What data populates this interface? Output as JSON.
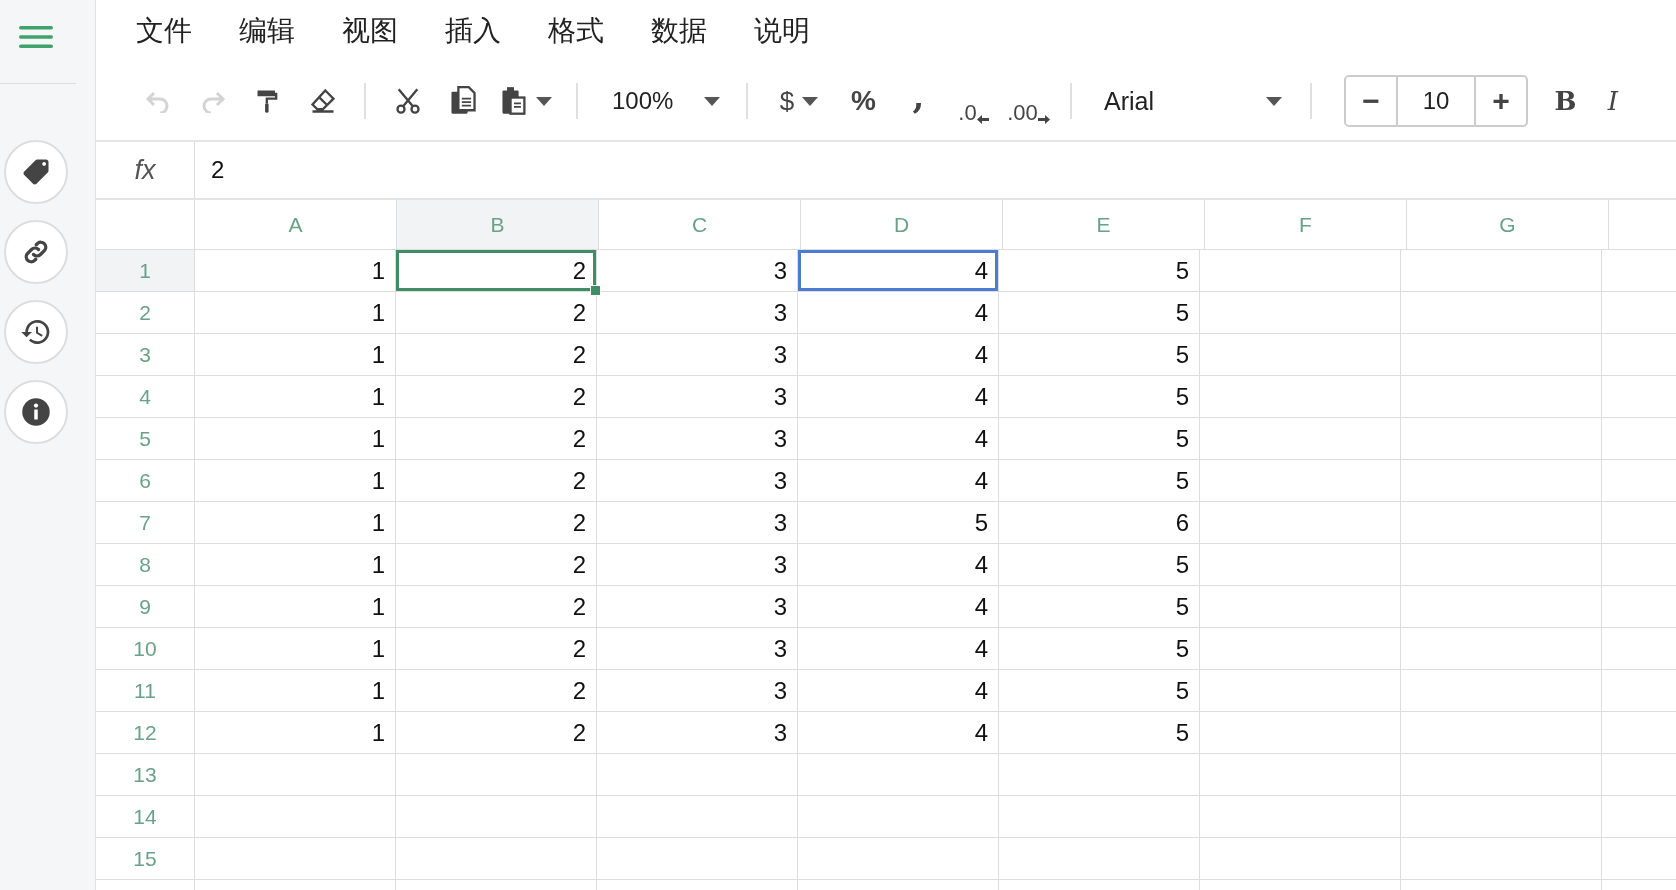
{
  "menu": [
    "文件",
    "编辑",
    "视图",
    "插入",
    "格式",
    "数据",
    "说明"
  ],
  "toolbar": {
    "undo": {
      "disabled": true
    },
    "redo": {
      "disabled": true
    },
    "zoom": "100%",
    "currency": "$",
    "percent": "%",
    "comma": ",",
    "decrease_decimals": ".0",
    "increase_decimals": ".00",
    "font": "Arial",
    "font_size": {
      "decrease": "−",
      "value": "10",
      "increase": "+"
    },
    "bold": "B",
    "italic": "I"
  },
  "formula_bar": {
    "label": "fx",
    "value": "2"
  },
  "columns": [
    {
      "label": "A",
      "selected": false
    },
    {
      "label": "B",
      "selected": true
    },
    {
      "label": "C",
      "selected": false
    },
    {
      "label": "D",
      "selected": false
    },
    {
      "label": "E",
      "selected": false
    },
    {
      "label": "F",
      "selected": false
    },
    {
      "label": "G",
      "selected": false
    }
  ],
  "rows": [
    {
      "label": "1",
      "selected": true,
      "cells": [
        {
          "value": "1",
          "selected": false,
          "peer_selected": false
        },
        {
          "value": "2",
          "selected": true,
          "peer_selected": false
        },
        {
          "value": "3",
          "selected": false,
          "peer_selected": false
        },
        {
          "value": "4",
          "selected": false,
          "peer_selected": true
        },
        {
          "value": "5",
          "selected": false,
          "peer_selected": false
        }
      ]
    },
    {
      "label": "2",
      "selected": false,
      "cells": [
        {
          "value": "1",
          "selected": false,
          "peer_selected": false
        },
        {
          "value": "2",
          "selected": false,
          "peer_selected": false
        },
        {
          "value": "3",
          "selected": false,
          "peer_selected": false
        },
        {
          "value": "4",
          "selected": false,
          "peer_selected": false
        },
        {
          "value": "5",
          "selected": false,
          "peer_selected": false
        }
      ]
    },
    {
      "label": "3",
      "selected": false,
      "cells": [
        {
          "value": "1",
          "selected": false,
          "peer_selected": false
        },
        {
          "value": "2",
          "selected": false,
          "peer_selected": false
        },
        {
          "value": "3",
          "selected": false,
          "peer_selected": false
        },
        {
          "value": "4",
          "selected": false,
          "peer_selected": false
        },
        {
          "value": "5",
          "selected": false,
          "peer_selected": false
        }
      ]
    },
    {
      "label": "4",
      "selected": false,
      "cells": [
        {
          "value": "1",
          "selected": false,
          "peer_selected": false
        },
        {
          "value": "2",
          "selected": false,
          "peer_selected": false
        },
        {
          "value": "3",
          "selected": false,
          "peer_selected": false
        },
        {
          "value": "4",
          "selected": false,
          "peer_selected": false
        },
        {
          "value": "5",
          "selected": false,
          "peer_selected": false
        }
      ]
    },
    {
      "label": "5",
      "selected": false,
      "cells": [
        {
          "value": "1",
          "selected": false,
          "peer_selected": false
        },
        {
          "value": "2",
          "selected": false,
          "peer_selected": false
        },
        {
          "value": "3",
          "selected": false,
          "peer_selected": false
        },
        {
          "value": "4",
          "selected": false,
          "peer_selected": false
        },
        {
          "value": "5",
          "selected": false,
          "peer_selected": false
        }
      ]
    },
    {
      "label": "6",
      "selected": false,
      "cells": [
        {
          "value": "1",
          "selected": false,
          "peer_selected": false
        },
        {
          "value": "2",
          "selected": false,
          "peer_selected": false
        },
        {
          "value": "3",
          "selected": false,
          "peer_selected": false
        },
        {
          "value": "4",
          "selected": false,
          "peer_selected": false
        },
        {
          "value": "5",
          "selected": false,
          "peer_selected": false
        }
      ]
    },
    {
      "label": "7",
      "selected": false,
      "cells": [
        {
          "value": "1",
          "selected": false,
          "peer_selected": false
        },
        {
          "value": "2",
          "selected": false,
          "peer_selected": false
        },
        {
          "value": "3",
          "selected": false,
          "peer_selected": false
        },
        {
          "value": "5",
          "selected": false,
          "peer_selected": false
        },
        {
          "value": "6",
          "selected": false,
          "peer_selected": false
        }
      ]
    },
    {
      "label": "8",
      "selected": false,
      "cells": [
        {
          "value": "1",
          "selected": false,
          "peer_selected": false
        },
        {
          "value": "2",
          "selected": false,
          "peer_selected": false
        },
        {
          "value": "3",
          "selected": false,
          "peer_selected": false
        },
        {
          "value": "4",
          "selected": false,
          "peer_selected": false
        },
        {
          "value": "5",
          "selected": false,
          "peer_selected": false
        }
      ]
    },
    {
      "label": "9",
      "selected": false,
      "cells": [
        {
          "value": "1",
          "selected": false,
          "peer_selected": false
        },
        {
          "value": "2",
          "selected": false,
          "peer_selected": false
        },
        {
          "value": "3",
          "selected": false,
          "peer_selected": false
        },
        {
          "value": "4",
          "selected": false,
          "peer_selected": false
        },
        {
          "value": "5",
          "selected": false,
          "peer_selected": false
        }
      ]
    },
    {
      "label": "10",
      "selected": false,
      "cells": [
        {
          "value": "1",
          "selected": false,
          "peer_selected": false
        },
        {
          "value": "2",
          "selected": false,
          "peer_selected": false
        },
        {
          "value": "3",
          "selected": false,
          "peer_selected": false
        },
        {
          "value": "4",
          "selected": false,
          "peer_selected": false
        },
        {
          "value": "5",
          "selected": false,
          "peer_selected": false
        }
      ]
    },
    {
      "label": "11",
      "selected": false,
      "cells": [
        {
          "value": "1",
          "selected": false,
          "peer_selected": false
        },
        {
          "value": "2",
          "selected": false,
          "peer_selected": false
        },
        {
          "value": "3",
          "selected": false,
          "peer_selected": false
        },
        {
          "value": "4",
          "selected": false,
          "peer_selected": false
        },
        {
          "value": "5",
          "selected": false,
          "peer_selected": false
        }
      ]
    },
    {
      "label": "12",
      "selected": false,
      "cells": [
        {
          "value": "1",
          "selected": false,
          "peer_selected": false
        },
        {
          "value": "2",
          "selected": false,
          "peer_selected": false
        },
        {
          "value": "3",
          "selected": false,
          "peer_selected": false
        },
        {
          "value": "4",
          "selected": false,
          "peer_selected": false
        },
        {
          "value": "5",
          "selected": false,
          "peer_selected": false
        }
      ]
    },
    {
      "label": "13",
      "selected": false,
      "cells": []
    },
    {
      "label": "14",
      "selected": false,
      "cells": []
    },
    {
      "label": "15",
      "selected": false,
      "cells": []
    }
  ]
}
